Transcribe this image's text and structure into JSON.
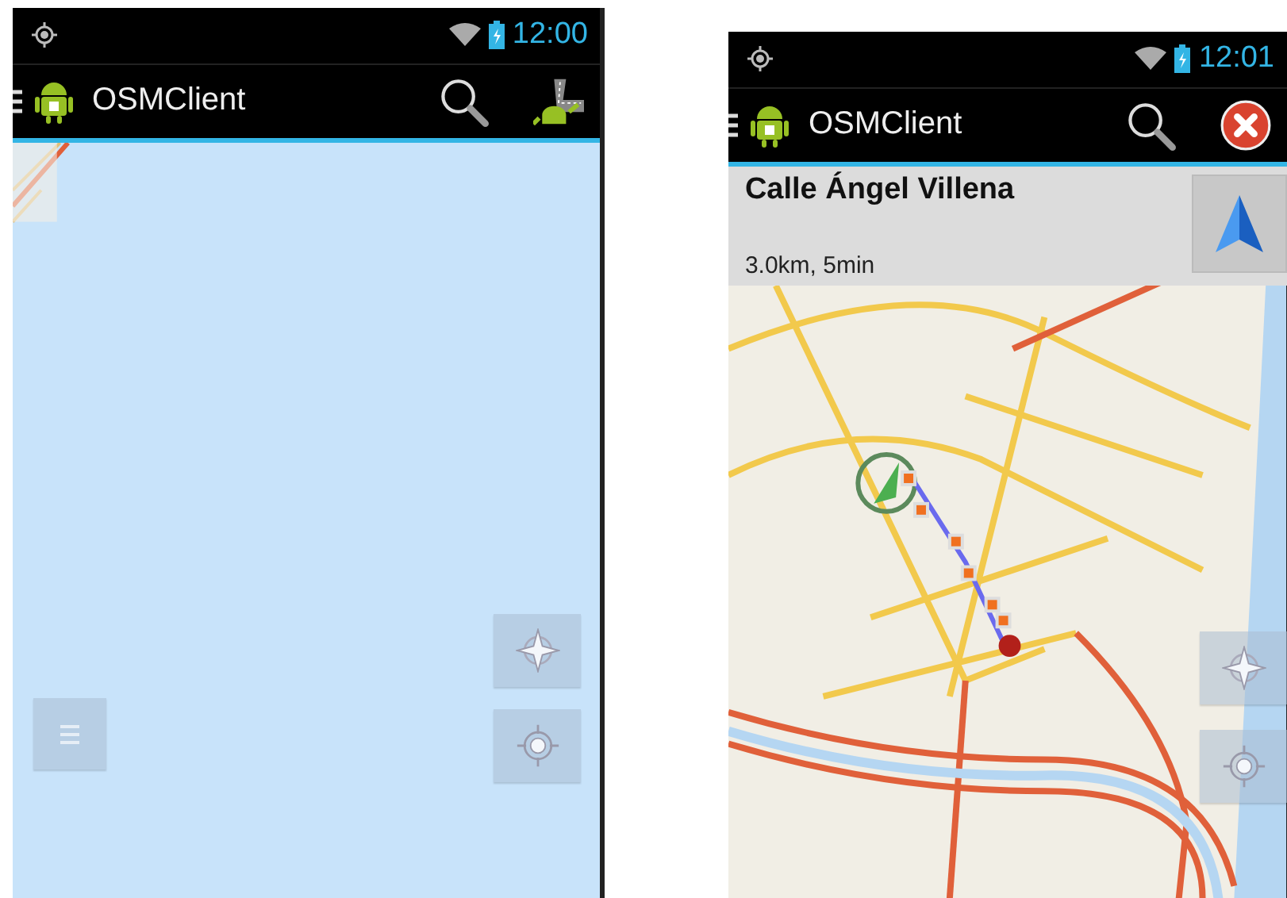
{
  "screens": [
    {
      "status_bar": {
        "time": "12:00"
      },
      "action_bar": {
        "title": "OSMClient",
        "actions": [
          {
            "kind": "search"
          },
          {
            "kind": "route"
          }
        ]
      },
      "map": {
        "kind": "water"
      },
      "map_buttons": [
        {
          "kind": "menu"
        },
        {
          "kind": "compass"
        },
        {
          "kind": "locate"
        }
      ]
    },
    {
      "status_bar": {
        "time": "12:01"
      },
      "action_bar": {
        "title": "OSMClient",
        "actions": [
          {
            "kind": "search"
          },
          {
            "kind": "close"
          }
        ]
      },
      "route_panel": {
        "street": "Calle Ángel Villena",
        "summary": "3.0km, 5min"
      },
      "map": {
        "kind": "city"
      },
      "map_buttons": [
        {
          "kind": "compass"
        },
        {
          "kind": "locate"
        }
      ]
    }
  ]
}
